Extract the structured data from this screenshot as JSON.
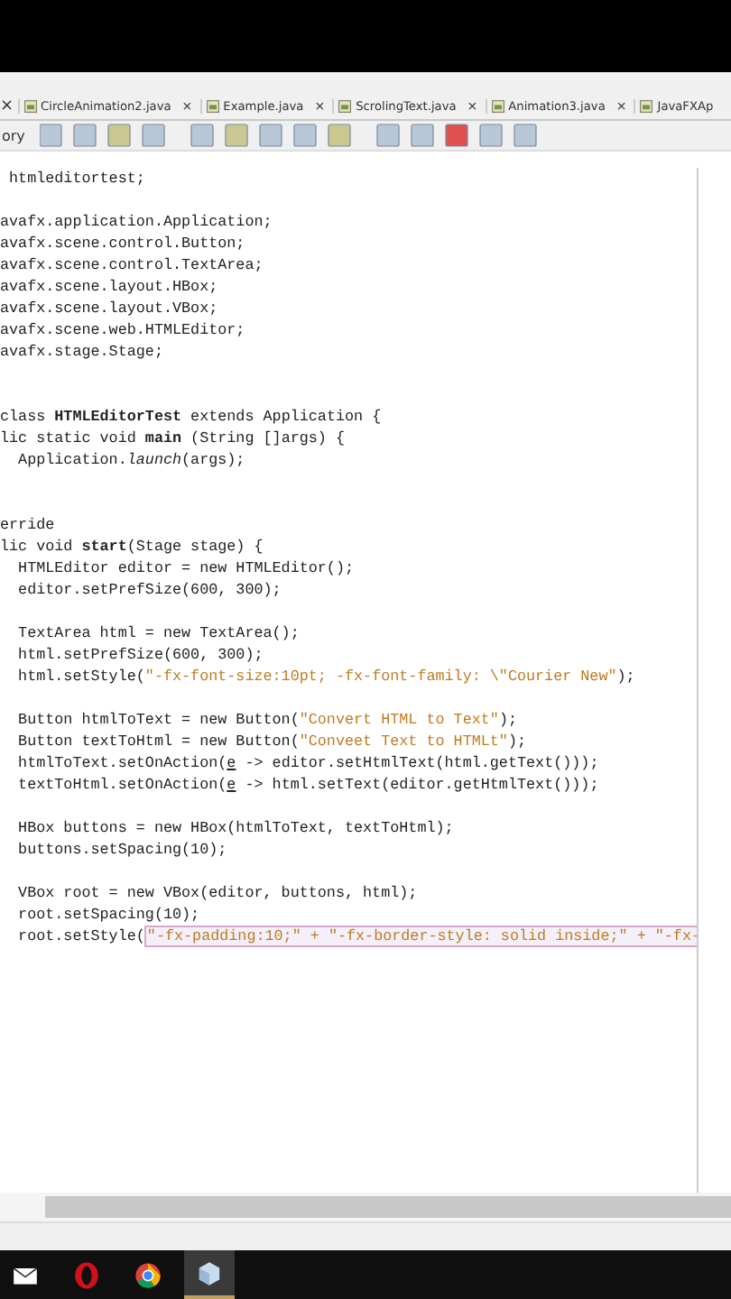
{
  "tabs": [
    {
      "label": "×",
      "kind": "close"
    },
    {
      "label": "CircleAnimation2.java",
      "close": "×",
      "kind": "file"
    },
    {
      "label": "Example.java",
      "close": "×",
      "kind": "file"
    },
    {
      "label": "ScrolingText.java",
      "close": "×",
      "kind": "file"
    },
    {
      "label": "Animation3.java",
      "close": "×",
      "kind": "file"
    },
    {
      "label": "JavaFXAp",
      "kind": "file"
    }
  ],
  "toolbar": {
    "label": "ory"
  },
  "code_lines": [
    {
      "kind": "code",
      "tokens": [
        {
          "kind": "plain",
          "text": " htmleditortest;"
        }
      ]
    },
    {
      "kind": "blank"
    },
    {
      "kind": "code",
      "tokens": [
        {
          "kind": "plain",
          "text": "avafx.application.Application;"
        }
      ]
    },
    {
      "kind": "code",
      "tokens": [
        {
          "kind": "plain",
          "text": "avafx.scene.control.Button;"
        }
      ]
    },
    {
      "kind": "code",
      "tokens": [
        {
          "kind": "plain",
          "text": "avafx.scene.control.TextArea;"
        }
      ]
    },
    {
      "kind": "code",
      "tokens": [
        {
          "kind": "plain",
          "text": "avafx.scene.layout.HBox;"
        }
      ]
    },
    {
      "kind": "code",
      "tokens": [
        {
          "kind": "plain",
          "text": "avafx.scene.layout.VBox;"
        }
      ]
    },
    {
      "kind": "code",
      "tokens": [
        {
          "kind": "plain",
          "text": "avafx.scene.web.HTMLEditor;"
        }
      ]
    },
    {
      "kind": "code",
      "tokens": [
        {
          "kind": "plain",
          "text": "avafx.stage.Stage;"
        }
      ]
    },
    {
      "kind": "blank"
    },
    {
      "kind": "blank"
    },
    {
      "kind": "code",
      "tokens": [
        {
          "kind": "plain",
          "text": "class "
        },
        {
          "kind": "bold",
          "text": "HTMLEditorTest"
        },
        {
          "kind": "plain",
          "text": " extends Application {"
        }
      ]
    },
    {
      "kind": "code",
      "tokens": [
        {
          "kind": "plain",
          "text": "lic static void "
        },
        {
          "kind": "bold",
          "text": "main"
        },
        {
          "kind": "plain",
          "text": " (String []args) {"
        }
      ]
    },
    {
      "kind": "code",
      "tokens": [
        {
          "kind": "plain",
          "text": "  Application."
        },
        {
          "kind": "italic",
          "text": "launch"
        },
        {
          "kind": "plain",
          "text": "(args);"
        }
      ]
    },
    {
      "kind": "blank"
    },
    {
      "kind": "blank"
    },
    {
      "kind": "code",
      "tokens": [
        {
          "kind": "plain",
          "text": "erride"
        }
      ]
    },
    {
      "kind": "code",
      "tokens": [
        {
          "kind": "plain",
          "text": "lic void "
        },
        {
          "kind": "bold",
          "text": "start"
        },
        {
          "kind": "plain",
          "text": "(Stage stage) {"
        }
      ]
    },
    {
      "kind": "code",
      "tokens": [
        {
          "kind": "plain",
          "text": "  HTMLEditor editor = new HTMLEditor();"
        }
      ]
    },
    {
      "kind": "code",
      "tokens": [
        {
          "kind": "plain",
          "text": "  editor.setPrefSize(600, 300);"
        }
      ]
    },
    {
      "kind": "blank"
    },
    {
      "kind": "code",
      "tokens": [
        {
          "kind": "plain",
          "text": "  TextArea html = new TextArea();"
        }
      ]
    },
    {
      "kind": "code",
      "tokens": [
        {
          "kind": "plain",
          "text": "  html.setPrefSize(600, 300);"
        }
      ]
    },
    {
      "kind": "code",
      "tokens": [
        {
          "kind": "plain",
          "text": "  html.setStyle("
        },
        {
          "kind": "string",
          "text": "\"-fx-font-size:10pt; -fx-font-family: \\\"Courier New\""
        },
        {
          "kind": "plain",
          "text": ");"
        }
      ]
    },
    {
      "kind": "blank"
    },
    {
      "kind": "code",
      "tokens": [
        {
          "kind": "plain",
          "text": "  Button htmlToText = new Button("
        },
        {
          "kind": "string",
          "text": "\"Convert HTML to Text\""
        },
        {
          "kind": "plain",
          "text": ");"
        }
      ]
    },
    {
      "kind": "code",
      "tokens": [
        {
          "kind": "plain",
          "text": "  Button textToHtml = new Button("
        },
        {
          "kind": "string",
          "text": "\"Conveet Text to HTMLt\""
        },
        {
          "kind": "plain",
          "text": ");"
        }
      ]
    },
    {
      "kind": "code",
      "tokens": [
        {
          "kind": "plain",
          "text": "  htmlToText.setOnAction("
        },
        {
          "kind": "warn",
          "text": "e"
        },
        {
          "kind": "plain",
          "text": " -> editor.setHtmlText(html.getText()));"
        }
      ]
    },
    {
      "kind": "code",
      "tokens": [
        {
          "kind": "plain",
          "text": "  textToHtml.setOnAction("
        },
        {
          "kind": "warn",
          "text": "e"
        },
        {
          "kind": "plain",
          "text": " -> html.setText(editor.getHtmlText()));"
        }
      ]
    },
    {
      "kind": "blank"
    },
    {
      "kind": "code",
      "tokens": [
        {
          "kind": "plain",
          "text": "  HBox buttons = new HBox(htmlToText, textToHtml);"
        }
      ]
    },
    {
      "kind": "code",
      "tokens": [
        {
          "kind": "plain",
          "text": "  buttons.setSpacing(10);"
        }
      ]
    },
    {
      "kind": "blank"
    },
    {
      "kind": "code",
      "tokens": [
        {
          "kind": "plain",
          "text": "  VBox root = new VBox(editor, buttons, html);"
        }
      ]
    },
    {
      "kind": "code",
      "tokens": [
        {
          "kind": "plain",
          "text": "  root.setSpacing(10);"
        }
      ]
    },
    {
      "kind": "code",
      "tokens": [
        {
          "kind": "plain",
          "text": "  root.setStyle("
        },
        {
          "kind": "hint",
          "text": "\"-fx-padding:10;\" + \"-fx-border-style: solid inside;\" + \"-fx-"
        }
      ]
    }
  ],
  "taskbar": [
    {
      "kind": "mail",
      "selected": false
    },
    {
      "kind": "opera",
      "selected": false
    },
    {
      "kind": "chrome",
      "selected": false
    },
    {
      "kind": "cube",
      "selected": true
    }
  ]
}
